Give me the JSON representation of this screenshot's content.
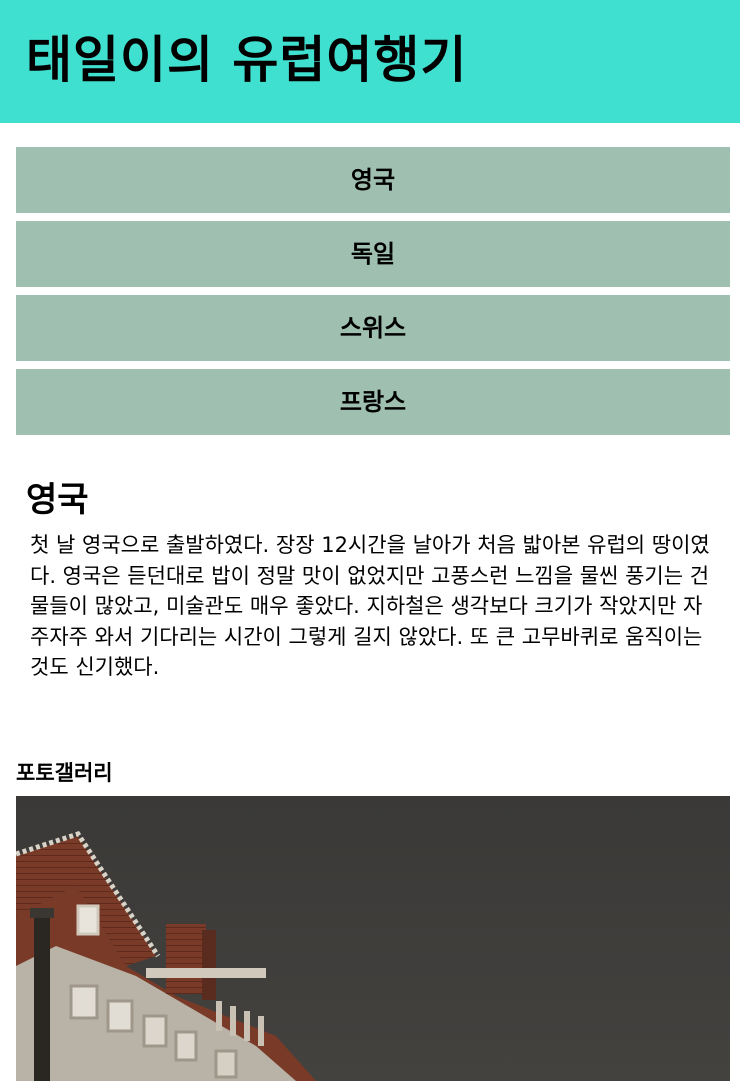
{
  "header": {
    "title": "태일이의 유럽여행기",
    "background_color": "#40e0d0"
  },
  "nav": {
    "items": [
      {
        "label": "영국"
      },
      {
        "label": "독일"
      },
      {
        "label": "스위스"
      },
      {
        "label": "프랑스"
      }
    ],
    "button_color": "#9fc0b0"
  },
  "section": {
    "title": "영국",
    "body": "첫 날 영국으로 출발하였다. 장장 12시간을 날아가 처음 밟아본 유럽의 땅이였다. 영국은 듣던대로 밥이 정말 맛이 없었지만 고풍스런 느낌을 물씬 풍기는 건물들이 많았고, 미술관도 매우 좋았다. 지하철은 생각보다 크기가 작았지만 자주자주 와서 기다리는 시간이 그렇게 길지 않았다. 또 큰 고무바퀴로 움직이는것도 신기했다."
  },
  "gallery": {
    "title": "포토갤러리",
    "photo_subject": "night-brick-building"
  }
}
